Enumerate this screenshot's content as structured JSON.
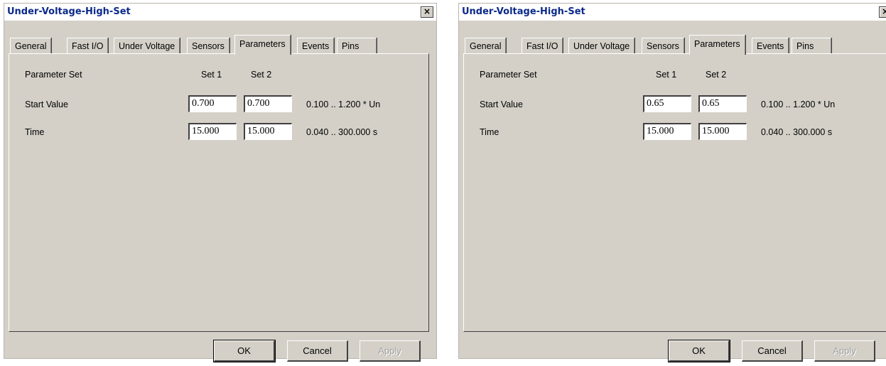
{
  "dialogs": [
    {
      "title": "Under-Voltage-High-Set",
      "close_glyph": "×",
      "tabs": [
        "General",
        "Fast I/O",
        "Under Voltage",
        "Sensors",
        "Parameters",
        "Events",
        "Pins"
      ],
      "active_tab": "Parameters",
      "parameter_set_label": "Parameter Set",
      "set1_label": "Set 1",
      "set2_label": "Set 2",
      "rows": [
        {
          "label": "Start Value",
          "set1": "0.700",
          "set2": "0.700",
          "range": "0.100 .. 1.200 * Un"
        },
        {
          "label": "Time",
          "set1": "15.000",
          "set2": "15.000",
          "range": "0.040 .. 300.000 s"
        }
      ],
      "buttons": {
        "ok": "OK",
        "cancel": "Cancel",
        "apply": "Apply"
      }
    },
    {
      "title": "Under-Voltage-High-Set",
      "close_glyph": "×",
      "tabs": [
        "General",
        "Fast I/O",
        "Under Voltage",
        "Sensors",
        "Parameters",
        "Events",
        "Pins"
      ],
      "active_tab": "Parameters",
      "parameter_set_label": "Parameter Set",
      "set1_label": "Set 1",
      "set2_label": "Set 2",
      "rows": [
        {
          "label": "Start Value",
          "set1": "0.65",
          "set2": "0.65",
          "range": "0.100 .. 1.200 * Un"
        },
        {
          "label": "Time",
          "set1": "15.000",
          "set2": "15.000",
          "range": "0.040 .. 300.000 s"
        }
      ],
      "buttons": {
        "ok": "OK",
        "cancel": "Cancel",
        "apply": "Apply"
      }
    }
  ]
}
